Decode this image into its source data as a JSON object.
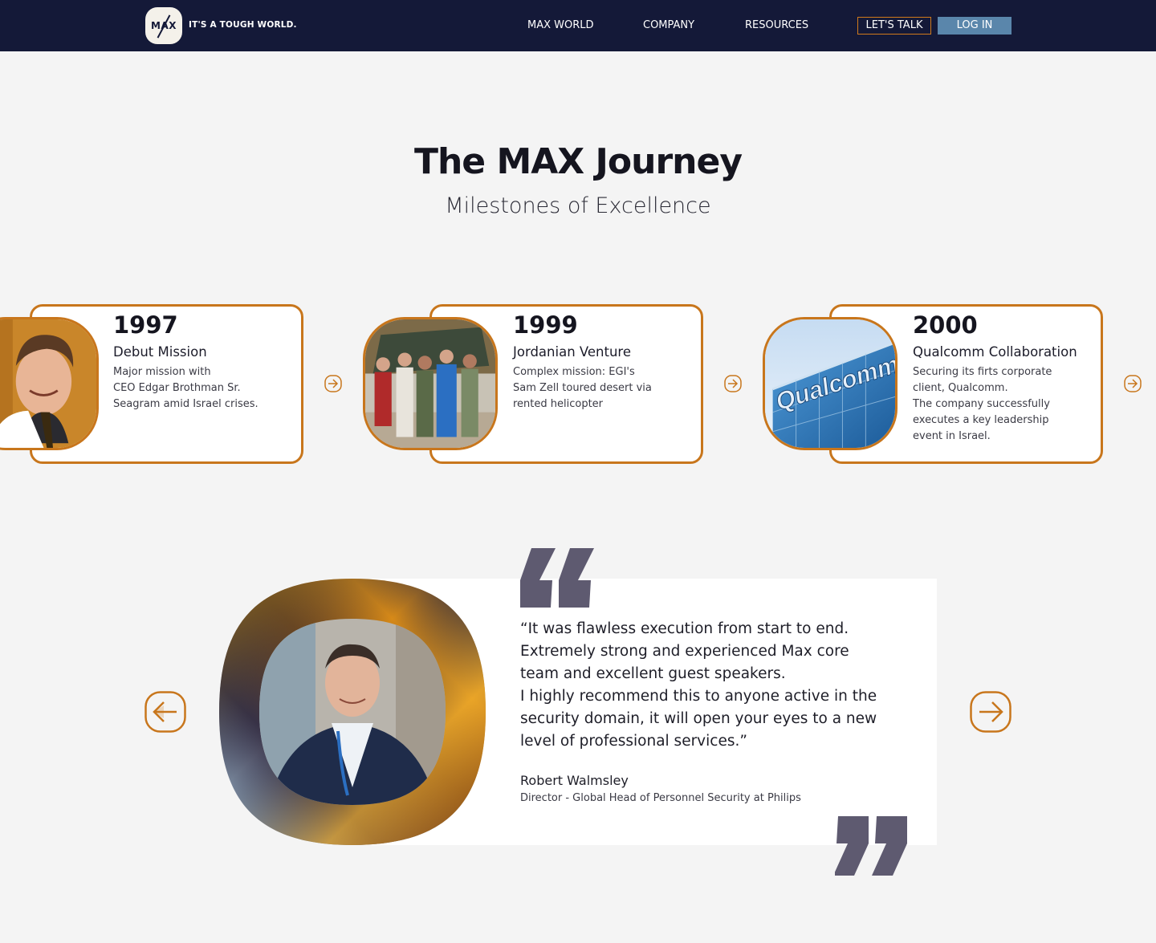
{
  "nav": {
    "logo_text": "MAX",
    "tagline": "IT'S A TOUGH WORLD.",
    "links": [
      "MAX WORLD",
      "COMPANY",
      "RESOURCES"
    ],
    "talk_label": "LET'S TALK",
    "login_label": "LOG IN"
  },
  "hero": {
    "title": "The MAX Journey",
    "subtitle": "Milestones of Excellence"
  },
  "milestones": [
    {
      "year": "1997",
      "title": "Debut Mission",
      "desc": "Major mission with\nCEO Edgar Brothman Sr.\nSeagram amid Israel crises.",
      "image": "portrait-photo"
    },
    {
      "year": "1999",
      "title": "Jordanian Venture",
      "desc": "Complex mission: EGI's\nSam Zell toured desert via\nrented helicopter",
      "image": "group-photo"
    },
    {
      "year": "2000",
      "title": "Qualcomm Collaboration",
      "desc": "Securing its firts corporate\nclient, Qualcomm.\nThe company successfully\nexecutes a key leadership\nevent in Israel.",
      "image": "qualcomm-building-photo",
      "sign_text": "Qualcomm"
    }
  ],
  "testimonial": {
    "quote": "“It was flawless execution from start to end.\n Extremely strong and experienced Max core\n team and excellent guest speakers.\n I highly recommend this to anyone active in the\n security domain, it will open your eyes to a new\n level of professional services.”",
    "name": "Robert Walmsley",
    "role": "Director - Global Head of Personnel Security at Philips"
  },
  "colors": {
    "nav_bg": "#141938",
    "accent": "#c8761c",
    "login_bg": "#5a86ab",
    "quote_mark": "#5e5a70",
    "page_bg": "#f4f4f4"
  },
  "icons": {
    "milestone_next": "arrow-right-icon",
    "testimonial_prev": "arrow-left-icon",
    "testimonial_next": "arrow-right-icon"
  }
}
